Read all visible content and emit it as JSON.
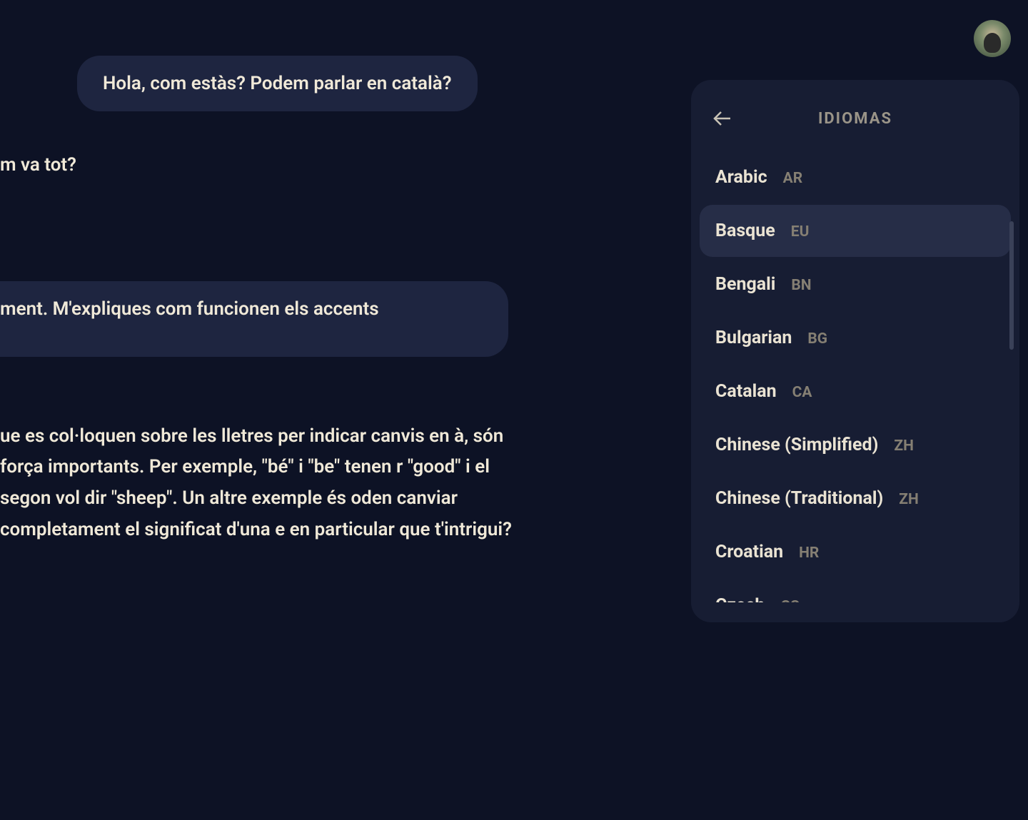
{
  "chat": {
    "user_msg_1": "Hola, com estàs? Podem parlar en català?",
    "assistant_msg_1": "m va tot?",
    "user_msg_2": "ment. M'expliques com funcionen els accents",
    "assistant_msg_2": "ue es col·loquen sobre les lletres per indicar canvis en à, són força importants. Per exemple, \"bé\" i \"be\" tenen r \"good\" i el segon vol dir \"sheep\". Un altre exemple és oden canviar completament el significat d'una e en particular que t'intrigui?"
  },
  "panel": {
    "title": "IDIOMAS",
    "languages": [
      {
        "name": "Arabic",
        "code": "AR",
        "selected": false
      },
      {
        "name": "Basque",
        "code": "EU",
        "selected": true
      },
      {
        "name": "Bengali",
        "code": "BN",
        "selected": false
      },
      {
        "name": "Bulgarian",
        "code": "BG",
        "selected": false
      },
      {
        "name": "Catalan",
        "code": "CA",
        "selected": false
      },
      {
        "name": "Chinese (Simplified)",
        "code": "ZH",
        "selected": false
      },
      {
        "name": "Chinese (Traditional)",
        "code": "ZH",
        "selected": false
      },
      {
        "name": "Croatian",
        "code": "HR",
        "selected": false
      },
      {
        "name": "Czech",
        "code": "CS",
        "selected": false
      }
    ]
  }
}
